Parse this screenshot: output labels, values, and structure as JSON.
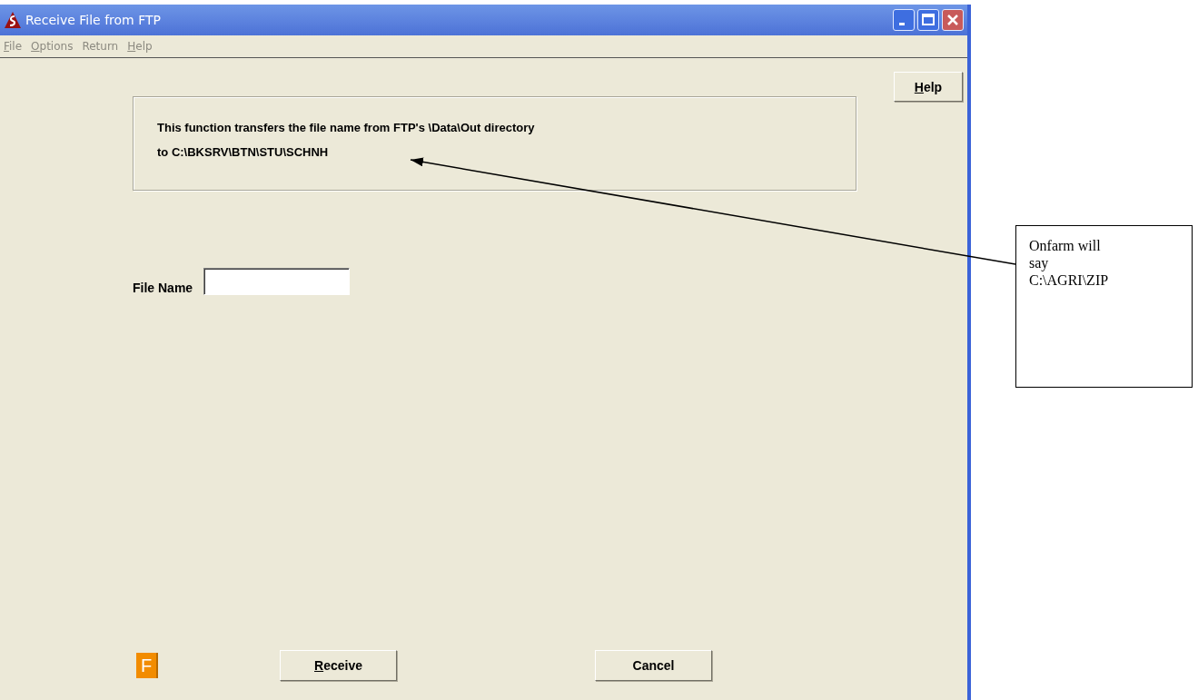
{
  "window": {
    "title": "Receive File from FTP"
  },
  "menu": [
    {
      "key": "F",
      "after": "ile",
      "disabled": true
    },
    {
      "key": "O",
      "after": "ptions",
      "disabled": true
    },
    {
      "after": "Return",
      "disabled": true
    },
    {
      "key": "H",
      "after": "elp",
      "disabled": true
    }
  ],
  "help_button": {
    "key": "H",
    "after": "elp"
  },
  "info": {
    "lines": [
      "This function transfers the file name from FTP's \\Data\\Out directory",
      "to C:\\BKSRV\\BTN\\STU\\SCHNH"
    ]
  },
  "file_name": {
    "label": "File Name"
  },
  "badge": "F",
  "buttons": [
    {
      "key": "R",
      "after": "eceive"
    },
    {
      "after": "Cancel"
    }
  ],
  "callout": {
    "text": "Onfarm will say C:\\AGRI\\ZIP"
  }
}
